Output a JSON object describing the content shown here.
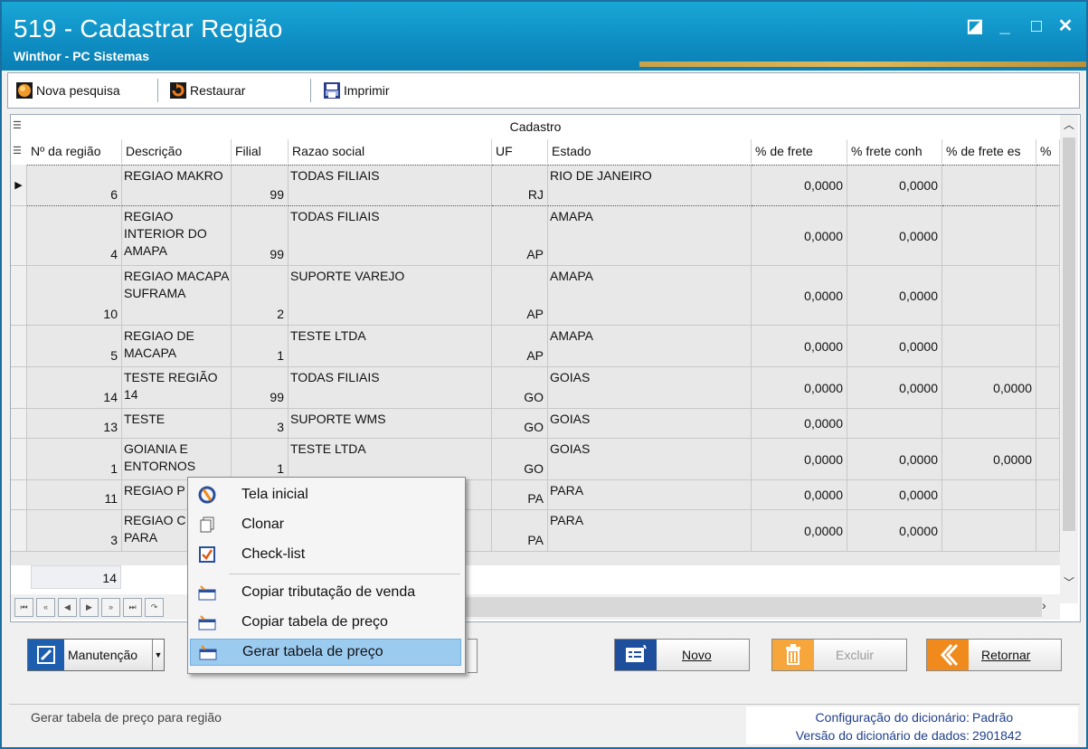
{
  "window": {
    "title": "519 - Cadastrar Região",
    "subtitle": "Winthor - PC Sistemas",
    "controls": {
      "restore": "◪",
      "minimize": "_",
      "maximize": "□",
      "close": "✕"
    }
  },
  "toolbar": {
    "nova_pesquisa": "Nova pesquisa",
    "restaurar": "Restaurar",
    "imprimir": "Imprimir"
  },
  "grid": {
    "group_header": "Cadastro",
    "columns": [
      "Nº da região",
      "Descrição",
      "Filial",
      "Razao social",
      "UF",
      "Estado",
      "% de frete",
      "% frete conh",
      "% de frete es",
      "%"
    ],
    "rows": [
      {
        "num": "6",
        "desc": "REGIAO MAKRO",
        "filial": "99",
        "razao": "TODAS FILIAIS",
        "uf": "RJ",
        "estado": "RIO DE JANEIRO",
        "frete": "0,0000",
        "frete_conh": "0,0000",
        "frete_es": ""
      },
      {
        "num": "4",
        "desc": "REGIAO INTERIOR DO AMAPA",
        "filial": "99",
        "razao": "TODAS FILIAIS",
        "uf": "AP",
        "estado": "AMAPA",
        "frete": "0,0000",
        "frete_conh": "0,0000",
        "frete_es": ""
      },
      {
        "num": "10",
        "desc": "REGIAO MACAPA SUFRAMA",
        "filial": "2",
        "razao": "SUPORTE VAREJO",
        "uf": "AP",
        "estado": "AMAPA",
        "frete": "0,0000",
        "frete_conh": "0,0000",
        "frete_es": ""
      },
      {
        "num": "5",
        "desc": "REGIAO DE MACAPA",
        "filial": "1",
        "razao": "TESTE  LTDA",
        "uf": "AP",
        "estado": "AMAPA",
        "frete": "0,0000",
        "frete_conh": "0,0000",
        "frete_es": ""
      },
      {
        "num": "14",
        "desc": "TESTE REGIÃO 14",
        "filial": "99",
        "razao": "TODAS FILIAIS",
        "uf": "GO",
        "estado": "GOIAS",
        "frete": "0,0000",
        "frete_conh": "0,0000",
        "frete_es": "0,0000"
      },
      {
        "num": "13",
        "desc": "TESTE",
        "filial": "3",
        "razao": "SUPORTE WMS",
        "uf": "GO",
        "estado": "GOIAS",
        "frete": "0,0000",
        "frete_conh": "",
        "frete_es": ""
      },
      {
        "num": "1",
        "desc": "GOIANIA E ENTORNOS",
        "filial": "1",
        "razao": "TESTE  LTDA",
        "uf": "GO",
        "estado": "GOIAS",
        "frete": "0,0000",
        "frete_conh": "0,0000",
        "frete_es": "0,0000"
      },
      {
        "num": "11",
        "desc": "REGIAO P",
        "filial": "",
        "razao": "",
        "uf": "PA",
        "estado": "PARA",
        "frete": "0,0000",
        "frete_conh": "0,0000",
        "frete_es": ""
      },
      {
        "num": "3",
        "desc": "REGIAO C DO PARA",
        "filial": "",
        "razao": "",
        "uf": "PA",
        "estado": "PARA",
        "frete": "0,0000",
        "frete_conh": "0,0000",
        "frete_es": ""
      }
    ],
    "footer_count": "14"
  },
  "buttons": {
    "manutencao": "Manutenção",
    "novo": "Novo",
    "excluir": "Excluir",
    "retornar": "Retornar"
  },
  "context_menu": {
    "items": [
      "Tela inicial",
      "Clonar",
      "Check-list",
      "Copiar tributação de venda",
      "Copiar tabela de preço",
      "Gerar tabela de preço"
    ],
    "highlighted": "Gerar tabela de preço"
  },
  "status": {
    "hint": "Gerar tabela de preço para região",
    "config_label": "Configuração do dicionário:",
    "config_value": "Padrão",
    "version_label": "Versão do dicionário de dados:",
    "version_value": "2901842"
  },
  "colors": {
    "title_bar": "#0f8fc4",
    "menu_highlight": "#9ccbf0",
    "excluir_orange": "#f6a63a",
    "retornar_orange": "#f08a1c",
    "novo_blue": "#1d4f9c"
  }
}
